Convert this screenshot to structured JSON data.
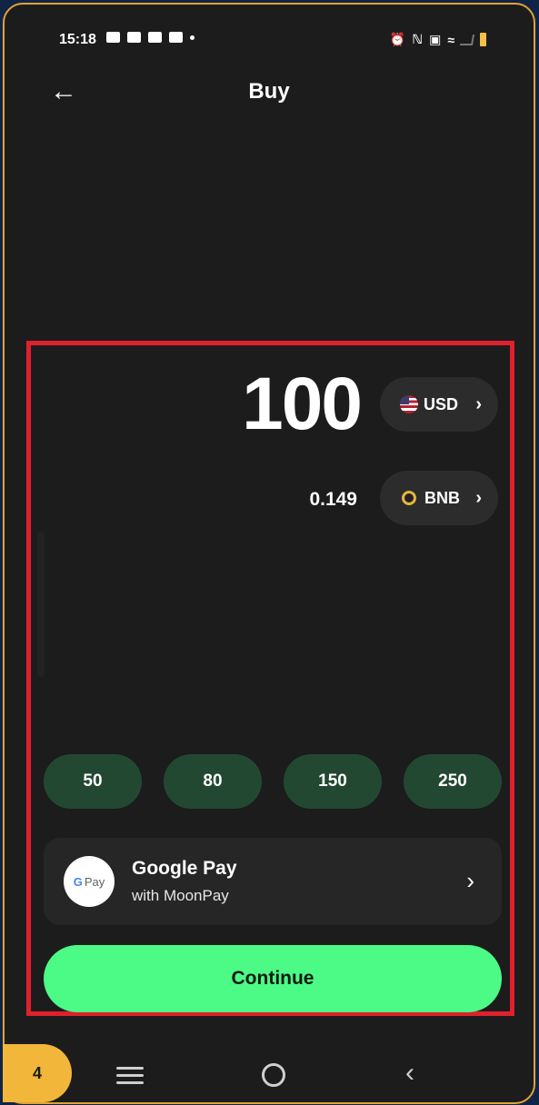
{
  "status_bar": {
    "time": "15:18",
    "right_icons": [
      "alarm-icon",
      "nfc-icon",
      "cast-icon",
      "wifi-icon",
      "signal-icon",
      "battery-icon"
    ]
  },
  "header": {
    "back_icon": "arrow-left-icon",
    "title": "Buy"
  },
  "amount": {
    "fiat_value": "100",
    "fiat_currency": "USD",
    "crypto_value": "0.149",
    "crypto_currency": "BNB"
  },
  "presets": [
    "50",
    "80",
    "150",
    "250"
  ],
  "payment": {
    "logo_text": "Pay",
    "logo_letter": "G",
    "title": "Google Pay",
    "subtitle": "with MoonPay"
  },
  "continue_label": "Continue",
  "step_badge": "4",
  "colors": {
    "background": "#1c1c1c",
    "accent": "#4cfa86",
    "preset_bg": "#234832",
    "highlight": "#e0202c",
    "frame": "#e2a431"
  }
}
